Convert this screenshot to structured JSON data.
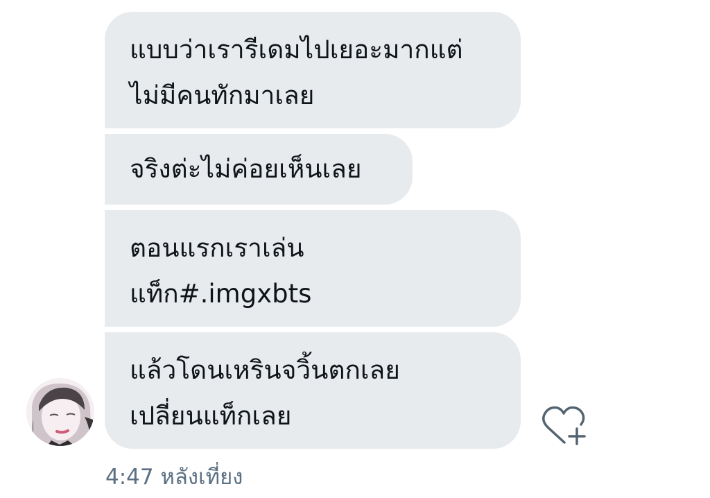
{
  "messages": [
    {
      "lines": [
        "แบบว่าเรารีเดมไปเยอะมากแต่",
        "ไม่มีคนทักมาเลย"
      ]
    },
    {
      "lines": [
        "จริงต่ะไม่ค่อยเห็นเลย"
      ]
    },
    {
      "lines": [
        "ตอนแรกเราเล่น",
        "แท็ก#.imgxbts"
      ]
    },
    {
      "lines": [
        "แล้วโดนเหรินจวิ้นตกเลย",
        "เปลี่ยนแท็กเลย"
      ]
    }
  ],
  "timestamp": "4:47 หลังเที่ยง",
  "icons": {
    "avatar": "sender-avatar",
    "reaction": "heart-plus-icon"
  },
  "colors": {
    "bubble": "#e8ebee",
    "text": "#0f1419",
    "meta": "#5b7083"
  }
}
